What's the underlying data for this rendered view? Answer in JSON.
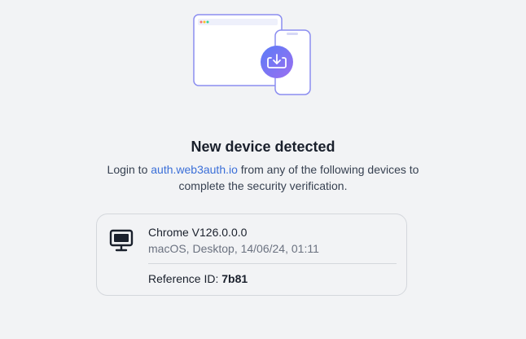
{
  "heading": {
    "title": "New device detected",
    "text_before_link": "Login to ",
    "link_text": "auth.web3auth.io",
    "text_after_link": " from any of the following devices to complete the security verification."
  },
  "device": {
    "icon": "desktop-monitor-icon",
    "name": "Chrome V126.0.0.0",
    "details": "macOS, Desktop, 14/06/24, 01:11",
    "reference_label": "Reference ID: ",
    "reference_id": "7b81"
  },
  "illustration": {
    "icon": "download-tray-icon"
  },
  "colors": {
    "accent": "#3b6fd8",
    "illustration_stroke": "#8b8df0",
    "badge_gradient_start": "#5b7cf7",
    "badge_gradient_end": "#9b6ff0"
  }
}
